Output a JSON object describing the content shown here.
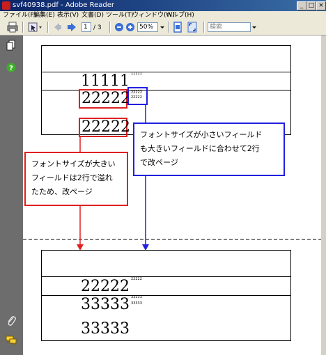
{
  "window": {
    "title": "svf40938.pdf - Adobe Reader",
    "buttons": {
      "minimize": "_",
      "maximize": "□",
      "close": "×"
    }
  },
  "menu": [
    "ファイル(F)",
    "編集(E)",
    "表示(V)",
    "文書(D)",
    "ツール(T)",
    "ウィンドウ(W)",
    "ヘルプ(H)"
  ],
  "toolbar": {
    "page_current": "1",
    "page_total": "/ 3",
    "zoom": "50%",
    "search_placeholder": "検索"
  },
  "page1": {
    "row1_big": "11111",
    "row1_small": "11111",
    "row2_big": "22222",
    "row2_small1": "22222",
    "row2_small2": "22222",
    "row3_big": "22222"
  },
  "page2": {
    "row1_big": "22222",
    "row1_small": "22222",
    "row2_big": "33333",
    "row2_small1": "33333",
    "row2_small2": "33333",
    "row3_big": "33333"
  },
  "callouts": {
    "red": [
      "フォントサイズが大きい",
      "フィールドは2行で溢れ",
      "たため、改ページ"
    ],
    "blue": [
      "フォントサイズが小さいフィールド",
      "も大きいフィールドに合わせて2行",
      "で改ページ"
    ]
  },
  "colors": {
    "red": "#e02020",
    "blue": "#2020e0"
  }
}
